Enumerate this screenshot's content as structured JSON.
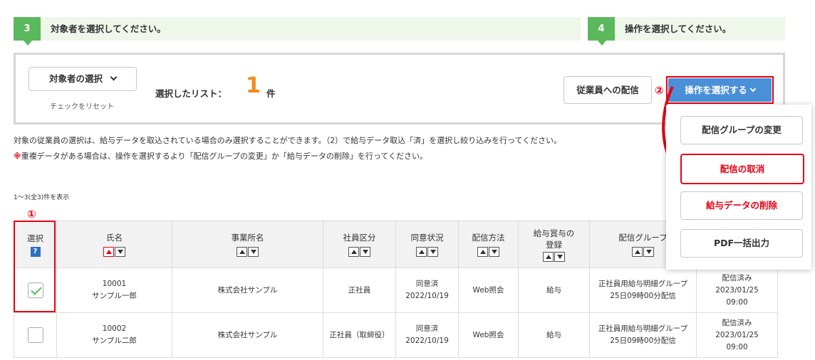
{
  "steps": [
    {
      "num": "3",
      "text": "対象者を選択してください。"
    },
    {
      "num": "4",
      "text": "操作を選択してください。"
    }
  ],
  "panel": {
    "target_button": "対象者の選択",
    "reset_link": "チェックをリセット",
    "selected_label": "選択したリスト：",
    "selected_count": "1",
    "selected_unit": "件",
    "deliver_button": "従業員への配信",
    "op_button": "操作を選択する"
  },
  "annotations": {
    "one": "①",
    "two": "②"
  },
  "notes": {
    "line1": "対象の従業員の選択は、給与データを取込されている場合のみ選択することができます。（2）で給与データ取込「済」を選択し絞り込みを行ってください。",
    "mark": "※",
    "line2": "重複データがある場合は、操作を選択するより「配信グループの変更」か「給与データの削除」を行ってください。"
  },
  "range_text": "1～3(全3)件を表示",
  "table": {
    "headers": {
      "select": "選択",
      "help": "?",
      "name": "氏名",
      "office": "事業所名",
      "type": "社員区分",
      "consent": "同意状況",
      "method": "配信方法",
      "reg_line1": "給与賞与の",
      "reg_line2": "登録",
      "group": "配信グループ"
    },
    "rows": [
      {
        "checked": true,
        "id": "10001",
        "name": "サンプル一郎",
        "office": "株式会社サンプル",
        "type": "正社員",
        "consent": "同意済",
        "consent_date": "2022/10/19",
        "method": "Web照会",
        "reg": "給与",
        "group1": "正社員用給与明細グループ",
        "group2": "25日09時00分配信",
        "st1": "配信済み",
        "st2": "2023/01/25",
        "st3": "09:00"
      },
      {
        "checked": false,
        "id": "10002",
        "name": "サンプル二郎",
        "office": "株式会社サンプル",
        "type": "正社員（取締役）",
        "consent": "同意済",
        "consent_date": "2022/10/19",
        "method": "Web照会",
        "reg": "給与",
        "group1": "正社員用給与明細グループ",
        "group2": "25日09時00分配信",
        "st1": "配信済み",
        "st2": "2023/01/25",
        "st3": "09:00"
      }
    ]
  },
  "menu": {
    "items": [
      {
        "label": "配信グループの変更"
      },
      {
        "label": "配信の取消"
      },
      {
        "label": "給与データの削除"
      },
      {
        "label": "PDF一括出力"
      }
    ]
  },
  "colors": {
    "step_green": "#5cb85c",
    "accent_blue": "#4a90d9",
    "highlight_red": "#e60012",
    "count_orange": "#f08c1e"
  }
}
